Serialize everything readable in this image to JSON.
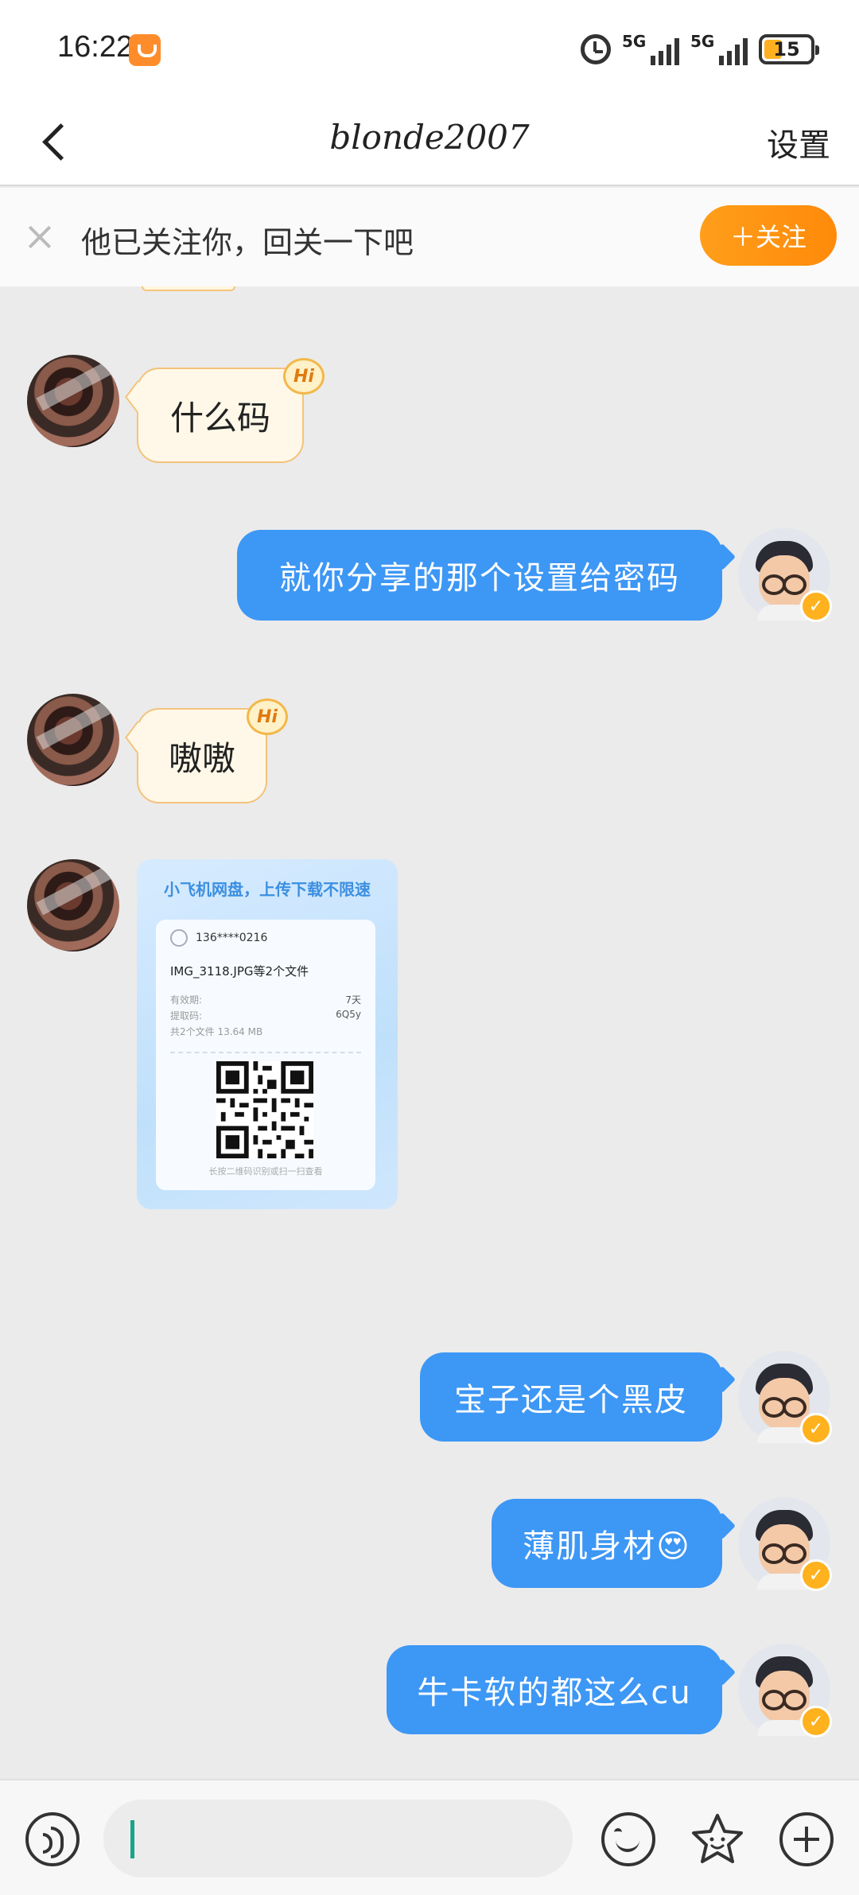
{
  "status_bar": {
    "time": "16:22",
    "signal_1_label": "5G",
    "signal_2_label": "5G",
    "battery": "15"
  },
  "header": {
    "back_icon": "chevron-left-icon",
    "title": "blonde2007",
    "settings_label": "设置"
  },
  "follow_banner": {
    "text": "他已关注你，回关一下吧",
    "button_label": "＋关注",
    "accent_color": "#ff9412"
  },
  "messages": [
    {
      "side": "left",
      "text": "什么码",
      "badge": "Hi"
    },
    {
      "side": "right",
      "text": "就你分享的那个设置给密码"
    },
    {
      "side": "left",
      "text": "嗷嗷",
      "badge": "Hi"
    },
    {
      "side": "left",
      "type": "share_card"
    },
    {
      "side": "right",
      "text": "宝子还是个黑皮"
    },
    {
      "side": "right",
      "text": "薄肌身材😍"
    },
    {
      "side": "right",
      "text": "牛卡软的都这么cu"
    }
  ],
  "share_card": {
    "title": "小飞机网盘，上传下载不限速",
    "phone": "136****0216",
    "filename": "IMG_3118.JPG等2个文件",
    "validity_label": "有效期:",
    "validity_value": "7天",
    "code_label": "提取码:",
    "code_value": "6Q5y",
    "summary": "共2个文件 13.64 MB",
    "caption": "长按二维码识别或扫一扫查看"
  },
  "input_bar": {
    "voice_icon": "voice-icon",
    "emoji_icon": "emoji-icon",
    "sticker_icon": "sticker-icon",
    "plus_icon": "plus-icon"
  },
  "colors": {
    "outgoing_bubble": "#3d97f5",
    "incoming_bubble": "#fff8e8",
    "chat_background": "#ebebeb"
  }
}
